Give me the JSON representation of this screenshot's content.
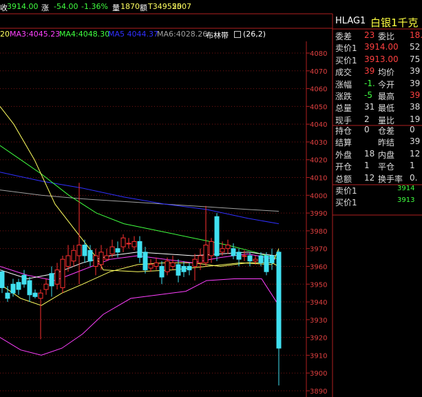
{
  "quote_bar": {
    "label_prefix": "收",
    "last": "3914.00",
    "change_label": "涨",
    "change": "-54.00",
    "change_pct": "-1.36%",
    "volume_label": "量",
    "volume": "1870",
    "amount_label": "额",
    "amount": "T349555",
    "year": "2007"
  },
  "ma_bar": {
    "ma2": "20",
    "ma3": "MA3:4045.23",
    "ma4": "MA4:4048.30",
    "ma5": "MA5 4044.37",
    "ma6": "MA6:4028.26",
    "boll_label": "布林带",
    "boll_params": "(26,2)"
  },
  "yaxis": [
    "4080",
    "4070",
    "4060",
    "4050",
    "4040",
    "4030",
    "4020",
    "4010",
    "4000",
    "3990",
    "3980",
    "3970",
    "3960",
    "3950",
    "3940",
    "3930",
    "3920",
    "3910",
    "3900",
    "3890"
  ],
  "right_panel": {
    "code": "HLAG1",
    "name": "白银1千克",
    "rows1": [
      {
        "label": "委差",
        "v1": "23",
        "label2": "委比",
        "v2": "18."
      },
      {
        "label": "卖价1",
        "v1": "3914.00",
        "label2": "",
        "v2": "52"
      },
      {
        "label": "买价1",
        "v1": "3913.00",
        "label2": "",
        "v2": "75"
      },
      {
        "label": "成交",
        "v1": "39",
        "label2": "均价",
        "v2": "39"
      },
      {
        "label": "涨幅",
        "v1": "-1.",
        "label2": "今开",
        "v2": "39"
      },
      {
        "label": "涨跌",
        "v1": "-5",
        "label2": "最高",
        "v2": "39"
      },
      {
        "label": "总量",
        "v1": "31",
        "label2": "最低",
        "v2": "38"
      },
      {
        "label": "现手",
        "v1": "2",
        "label2": "量比",
        "v2": "19"
      }
    ],
    "rows2": [
      {
        "label": "持仓",
        "v1": "0",
        "label2": "仓差",
        "v2": "0"
      },
      {
        "label": "结算",
        "v1": "",
        "label2": "昨结",
        "v2": "39"
      },
      {
        "label": "外盘",
        "v1": "18",
        "label2": "内盘",
        "v2": "12"
      },
      {
        "label": "开仓",
        "v1": "1",
        "label2": "平仓",
        "v2": "1"
      },
      {
        "label": "总额",
        "v1": "12",
        "label2": "换手率",
        "v2": "0."
      }
    ],
    "rows3": [
      {
        "label": "卖价1",
        "v": "3914"
      },
      {
        "label": "买价1",
        "v": "3913"
      }
    ]
  },
  "colors": {
    "up": "#ff3030",
    "down": "#40e0f0",
    "grid": "#8b1a1a",
    "ma2": "#ffff60",
    "ma3": "#ff40ff",
    "ma4": "#40ff40",
    "ma5": "#3030ff",
    "ma6": "#a0a0a0"
  }
}
